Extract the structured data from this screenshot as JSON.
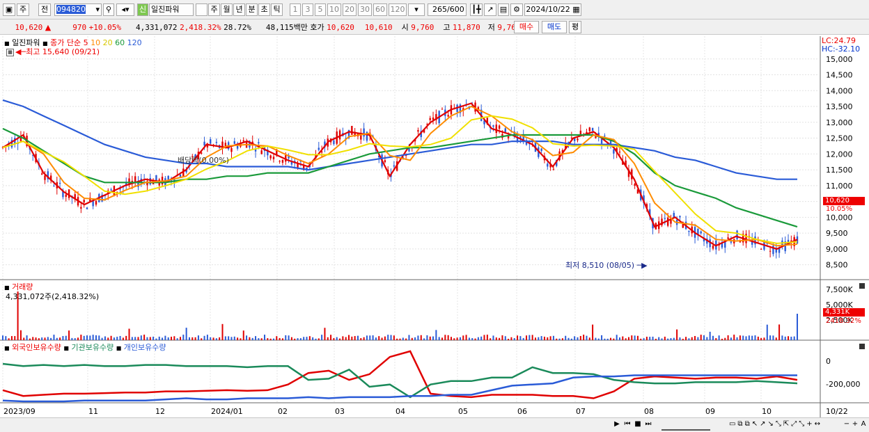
{
  "toolbar1": {
    "view_btn": "주",
    "type_btn": "전",
    "code": "094820",
    "credit_badge": "신",
    "stock_name": "일진파워",
    "periods": [
      "일",
      "주",
      "월",
      "년",
      "분",
      "초",
      "틱"
    ],
    "active_period": "일",
    "intervals": [
      "1",
      "3",
      "5",
      "10",
      "20",
      "30",
      "60",
      "120"
    ],
    "count": "265",
    "total": "/600",
    "date": "2024/10/22"
  },
  "quote": {
    "price": "10,620",
    "change_arrow": "▲",
    "change": "970",
    "change_pct": "+10.05%",
    "volume": "4,331,072",
    "vol_ratio": "2,418.32%",
    "turnover": "28.72%",
    "amount": "48,115백만",
    "bid_label": "호가",
    "ask": "10,620",
    "bid": "10,610",
    "open_label": "시",
    "open": "9,760",
    "high_label": "고",
    "high": "11,870",
    "low_label": "저",
    "low": "9,760",
    "buy_btn": "매수",
    "sell_btn": "매도",
    "eval_btn": "평"
  },
  "price_pane": {
    "stock_label": "일진파워",
    "ma_label": "종가 단순",
    "ma_periods": [
      "5",
      "10",
      "20",
      "60",
      "120"
    ],
    "ma_colors": [
      "#e00000",
      "#ff8c00",
      "#f0e000",
      "#1a9a3a",
      "#2a5bd7"
    ],
    "high_annotation": "최고 15,640 (09/21)",
    "low_annotation": "최저 8,510 (08/05)",
    "dividend_annotation": "배당락(0.00%)",
    "lc": "LC:24.79",
    "hc": "HC:-32.10",
    "y_ticks": [
      "15,000",
      "14,500",
      "14,000",
      "13,500",
      "13,000",
      "12,500",
      "12,000",
      "11,500",
      "11,000",
      "10,500",
      "10,000",
      "9,500",
      "9,000",
      "8,500"
    ],
    "last_price_tag": "10,620",
    "last_pct_tag": "10.05%"
  },
  "volume_pane": {
    "title": "거래량",
    "value": "4,331,072주(2,418.32%)",
    "y_ticks": [
      "7,500K",
      "5,000K",
      "2,500K"
    ],
    "last_tag": "4,331K",
    "last_pct": "2418.32%"
  },
  "holding_pane": {
    "legend": [
      "외국인보유수량",
      "기관보유수량",
      "개인보유수량"
    ],
    "legend_colors": [
      "#e00000",
      "#1a8a5a",
      "#2a5bd7"
    ],
    "y_ticks": [
      "0",
      "-200,000"
    ]
  },
  "x_axis": [
    "2023/09",
    "11",
    "12",
    "2024/01",
    "02",
    "03",
    "04",
    "05",
    "06",
    "07",
    "08",
    "09",
    "10"
  ],
  "x_axis_end": "10/22",
  "chart_data": {
    "type": "line",
    "title": "일진파워",
    "x_range": [
      "2023/09",
      "2024/10/22"
    ],
    "y_range": [
      8250,
      15500
    ],
    "moving_averages": [
      {
        "name": "5",
        "values": [
          12200,
          12600,
          11400,
          10800,
          10400,
          10700,
          11000,
          11200,
          11100,
          11500,
          12300,
          12200,
          12400,
          12100,
          11800,
          11600,
          12400,
          12700,
          12600,
          11300,
          12300,
          13000,
          13400,
          13600,
          12800,
          12600,
          12300,
          11600,
          12500,
          12700,
          12200,
          11200,
          9700,
          10000,
          9500,
          9100,
          9400,
          9200,
          9000,
          9300
        ]
      },
      {
        "name": "120",
        "values": [
          13700,
          13500,
          13200,
          12900,
          12600,
          12300,
          12100,
          11900,
          11800,
          11700,
          11700,
          11600,
          11600,
          11600,
          11600,
          11500,
          11600,
          11700,
          11800,
          11900,
          12000,
          12100,
          12200,
          12300,
          12300,
          12400,
          12400,
          12400,
          12300,
          12300,
          12300,
          12200,
          12100,
          11900,
          11800,
          11600,
          11400,
          11300,
          11200,
          11200
        ]
      },
      {
        "name": "60",
        "values": [
          12800,
          12500,
          12100,
          11700,
          11300,
          11100,
          11100,
          11100,
          11100,
          11200,
          11200,
          11300,
          11300,
          11400,
          11400,
          11400,
          11600,
          11800,
          12000,
          12100,
          12200,
          12200,
          12300,
          12400,
          12500,
          12600,
          12600,
          12600,
          12600,
          12600,
          12400,
          12000,
          11400,
          11000,
          10800,
          10600,
          10300,
          10100,
          9900,
          9700
        ]
      }
    ],
    "holdings": [
      {
        "name": "외국인보유수량",
        "values": [
          -230000,
          -280000,
          -270000,
          -260000,
          -260000,
          -255000,
          -250000,
          -250000,
          -240000,
          -240000,
          -235000,
          -230000,
          -235000,
          -230000,
          -180000,
          -80000,
          -60000,
          -140000,
          -90000,
          60000,
          110000,
          -260000,
          -280000,
          -290000,
          -270000,
          -270000,
          -270000,
          -280000,
          -280000,
          -300000,
          -240000,
          -130000,
          -110000,
          -120000,
          -130000,
          -120000,
          -120000,
          -130000,
          -110000,
          -140000
        ]
      },
      {
        "name": "기관보유수량",
        "values": [
          0,
          -20000,
          -10000,
          -20000,
          -10000,
          -20000,
          -20000,
          -10000,
          -10000,
          -20000,
          -20000,
          -20000,
          -30000,
          -20000,
          -20000,
          -140000,
          -130000,
          -50000,
          -200000,
          -180000,
          -290000,
          -180000,
          -150000,
          -150000,
          -120000,
          -120000,
          -30000,
          -80000,
          -80000,
          -90000,
          -140000,
          -160000,
          -170000,
          -170000,
          -160000,
          -160000,
          -160000,
          -150000,
          -160000,
          -170000
        ]
      },
      {
        "name": "개인보유수량",
        "values": [
          -320000,
          -330000,
          -330000,
          -330000,
          -320000,
          -320000,
          -320000,
          -320000,
          -310000,
          -300000,
          -310000,
          -310000,
          -300000,
          -300000,
          -300000,
          -290000,
          -300000,
          -290000,
          -290000,
          -290000,
          -280000,
          -280000,
          -270000,
          -270000,
          -230000,
          -190000,
          -180000,
          -170000,
          -120000,
          -110000,
          -110000,
          -100000,
          -100000,
          -100000,
          -100000,
          -100000,
          -100000,
          -100000,
          -100000,
          -100000
        ]
      }
    ]
  }
}
